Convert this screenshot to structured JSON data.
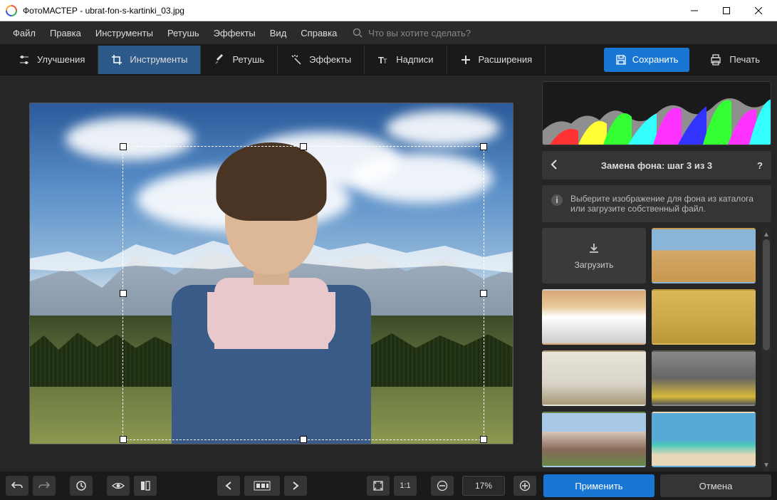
{
  "window": {
    "title": "ФотоМАСТЕР - ubrat-fon-s-kartinki_03.jpg"
  },
  "menubar": {
    "items": [
      "Файл",
      "Правка",
      "Инструменты",
      "Ретушь",
      "Эффекты",
      "Вид",
      "Справка"
    ],
    "search_placeholder": "Что вы хотите сделать?"
  },
  "toolbar": {
    "tabs": {
      "enhance": "Улучшения",
      "tools": "Инструменты",
      "retouch": "Ретушь",
      "effects": "Эффекты",
      "text": "Надписи",
      "extensions": "Расширения"
    },
    "save_label": "Сохранить",
    "print_label": "Печать"
  },
  "right_panel": {
    "title": "Замена фона: шаг 3 из 3",
    "info": "Выберите изображение для фона из каталога или загрузите собственный файл.",
    "upload_label": "Загрузить",
    "thumbs": [
      "desert",
      "winter-road",
      "autumn-park",
      "living-room",
      "city-street",
      "european-town",
      "tropical-beach"
    ]
  },
  "bottombar": {
    "ratio_label": "1:1",
    "zoom_value": "17%",
    "apply_label": "Применить",
    "cancel_label": "Отмена"
  }
}
